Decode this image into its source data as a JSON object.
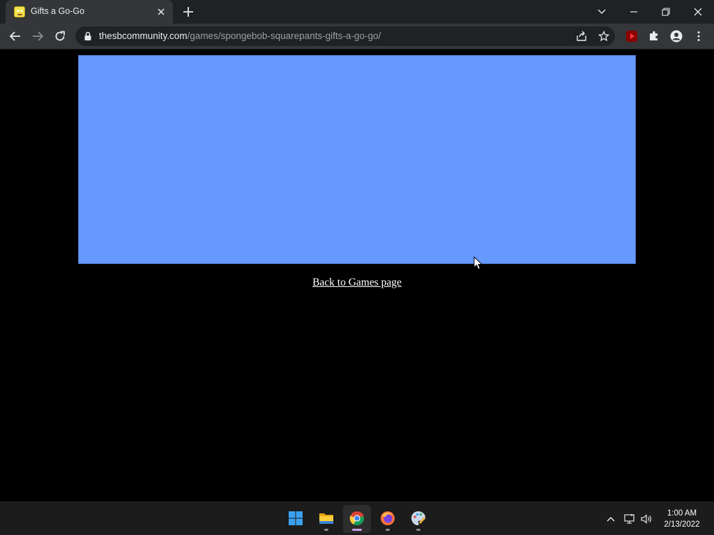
{
  "browser": {
    "tab": {
      "title": "Gifts a Go-Go",
      "favicon": "spongebob-favicon"
    },
    "address_bar": {
      "host": "thesbcommunity.com",
      "path": "/games/spongebob-squarepants-gifts-a-go-go/"
    }
  },
  "page": {
    "game_background_color": "#6699ff",
    "back_link_label": "Back to Games page"
  },
  "taskbar": {
    "apps": [
      "windows-start-icon",
      "file-explorer-icon",
      "chrome-icon",
      "firefox-icon",
      "paint-icon"
    ],
    "active_app": "chrome-icon",
    "clock": {
      "time": "1:00 AM",
      "date": "2/13/2022"
    }
  }
}
